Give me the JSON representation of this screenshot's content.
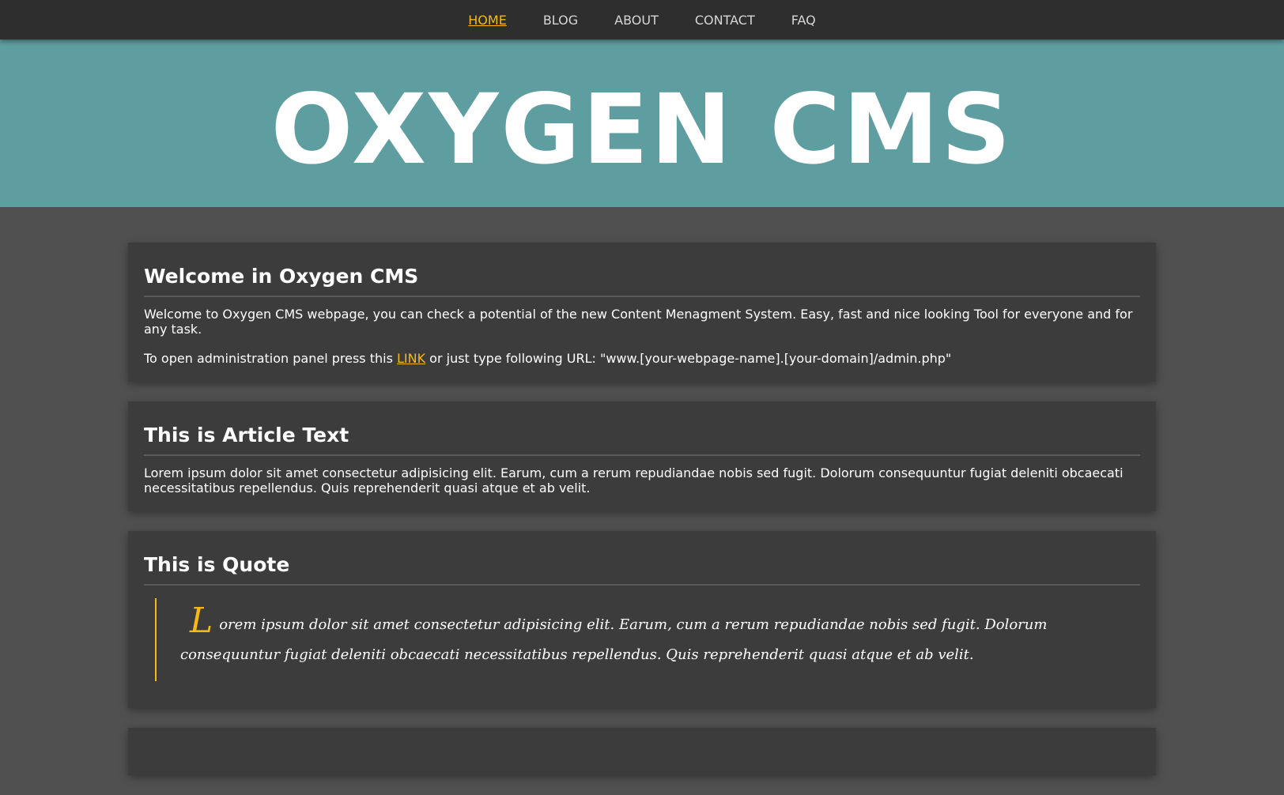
{
  "nav": {
    "items": [
      {
        "label": "HOME",
        "active": true
      },
      {
        "label": "BLOG",
        "active": false
      },
      {
        "label": "ABOUT",
        "active": false
      },
      {
        "label": "CONTACT",
        "active": false
      },
      {
        "label": "FAQ",
        "active": false
      }
    ]
  },
  "hero": {
    "title": "OXYGEN CMS"
  },
  "welcome": {
    "heading": "Welcome in Oxygen CMS",
    "paragraph": "Welcome to Oxygen CMS webpage, you can check a potential of the new Content Menagment System. Easy, fast and nice looking Tool for everyone and for any task.",
    "admin_prefix": "To open administration panel press this ",
    "admin_link": "LINK",
    "admin_suffix": " or just type following URL: \"www.[your-webpage-name].[your-domain]/admin.php\""
  },
  "article": {
    "heading": "This is Article Text",
    "paragraph": "Lorem ipsum dolor sit amet consectetur adipisicing elit. Earum, cum a rerum repudiandae nobis sed fugit. Dolorum consequuntur fugiat deleniti obcaecati necessitatibus repellendus. Quis reprehenderit quasi atque et ab velit."
  },
  "quote": {
    "heading": "This is Quote",
    "dropcap": "L",
    "text": "orem ipsum dolor sit amet consectetur adipisicing elit. Earum, cum a rerum repudiandae nobis sed fugit. Dolorum consequuntur fugiat deleniti obcaecati necessitatibus repellendus. Quis reprehenderit quasi atque et ab velit."
  },
  "colors": {
    "nav_bg": "#2e2e2e",
    "hero_bg": "#5f9ea0",
    "page_bg": "#505050",
    "card_bg": "#3c3c3c",
    "accent": "#f5b817"
  }
}
